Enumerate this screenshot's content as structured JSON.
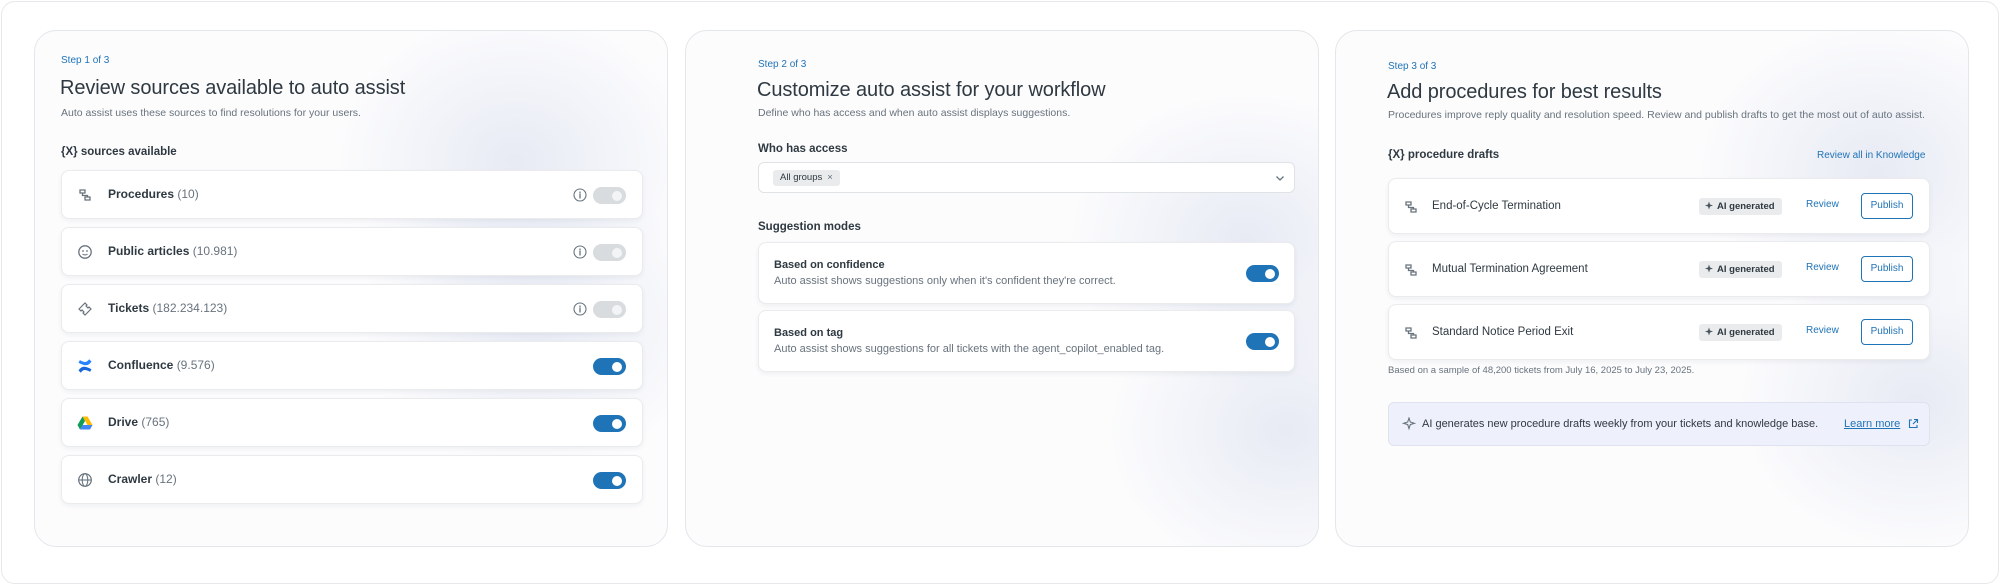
{
  "step1": {
    "step_label": "Step 1 of 3",
    "title": "Review sources available to auto assist",
    "subtitle": "Auto assist uses these sources to find resolutions for your users.",
    "section": "{X} sources available",
    "sources": [
      {
        "name": "Procedures",
        "count": "(10)",
        "icon": "procedure-icon",
        "enabled": false,
        "info": true
      },
      {
        "name": "Public articles",
        "count": "(10.981)",
        "icon": "article-icon",
        "enabled": false,
        "info": true
      },
      {
        "name": "Tickets",
        "count": "(182.234.123)",
        "icon": "ticket-icon",
        "enabled": false,
        "info": true
      },
      {
        "name": "Confluence",
        "count": "(9.576)",
        "icon": "confluence-icon",
        "enabled": true,
        "info": false
      },
      {
        "name": "Drive",
        "count": "(765)",
        "icon": "drive-icon",
        "enabled": true,
        "info": false
      },
      {
        "name": "Crawler",
        "count": "(12)",
        "icon": "globe-icon",
        "enabled": true,
        "info": false
      }
    ]
  },
  "step2": {
    "step_label": "Step 2 of 3",
    "title": "Customize auto assist for your workflow",
    "subtitle": "Define who has access and when auto assist displays suggestions.",
    "access_label": "Who has access",
    "access_tag": "All groups",
    "modes_label": "Suggestion modes",
    "modes": [
      {
        "title": "Based on confidence",
        "desc": "Auto assist shows suggestions only when it's confident they're correct.",
        "enabled": true
      },
      {
        "title": "Based on tag",
        "desc": "Auto assist shows suggestions for all tickets with the agent_copilot_enabled tag.",
        "enabled": true
      }
    ]
  },
  "step3": {
    "step_label": "Step 3 of 3",
    "title": "Add procedures for best results",
    "subtitle": "Procedures improve reply quality and resolution speed. Review and publish drafts to get the most out of auto assist.",
    "section": "{X} procedure drafts",
    "review_all": "Review all in Knowledge",
    "badge_label": "AI generated",
    "review_label": "Review",
    "publish_label": "Publish",
    "drafts": [
      {
        "name": "End-of-Cycle Termination"
      },
      {
        "name": "Mutual Termination Agreement"
      },
      {
        "name": "Standard Notice Period Exit"
      }
    ],
    "note": "Based on a sample of 48,200 tickets from July 16, 2025 to July 23, 2025.",
    "banner_text": "AI generates new procedure drafts weekly from your tickets and knowledge base.",
    "banner_link": "Learn more"
  },
  "colors": {
    "accent": "#1f73b7",
    "text": "#2f3941",
    "muted": "#68737d",
    "toggle_off": "#d8dcde"
  }
}
